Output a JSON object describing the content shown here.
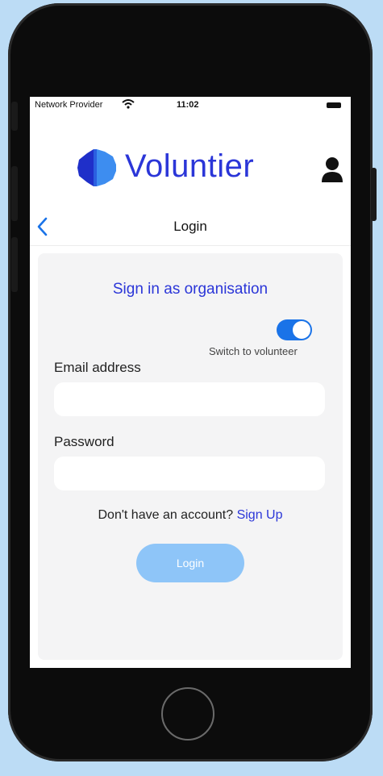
{
  "status_bar": {
    "provider": "Network Provider",
    "time": "11:02"
  },
  "header": {
    "brand_name": "Voluntier"
  },
  "nav": {
    "title": "Login"
  },
  "form": {
    "heading": "Sign in as organisation",
    "toggle_label": "Switch to volunteer",
    "toggle_on": true,
    "email_label": "Email address",
    "email_value": "",
    "password_label": "Password",
    "password_value": "",
    "no_account_text": "Don't have an account?",
    "signup_link": "Sign Up",
    "login_button": "Login"
  },
  "colors": {
    "brand": "#2b36d8",
    "accent": "#1a73e8",
    "login_button": "#8ec5f8",
    "background": "#bcdcf5"
  },
  "icons": [
    "wifi-icon",
    "battery-icon",
    "logo-icon",
    "user-icon",
    "back-chevron-icon"
  ]
}
